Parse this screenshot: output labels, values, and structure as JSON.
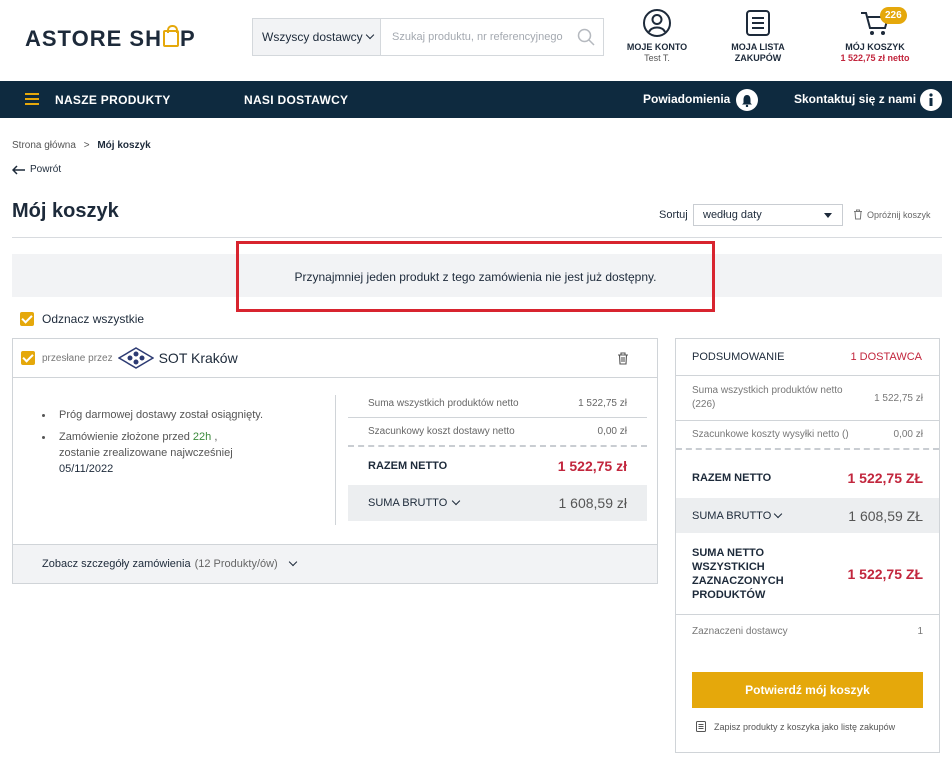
{
  "header": {
    "logo": {
      "part1": "ASTORE SH",
      "part2": "P"
    },
    "search": {
      "supplier_select": "Wszyscy dostawcy",
      "placeholder": "Szukaj produktu, nr referencyjnego"
    },
    "account": {
      "label": "MOJE KONTO",
      "user": "Test T."
    },
    "list": {
      "label_line1": "MOJA LISTA",
      "label_line2": "ZAKUPÓW"
    },
    "cart": {
      "label": "MÓJ KOSZYK",
      "badge": "226",
      "total": "1 522,75 zł netto"
    }
  },
  "nav": {
    "products": "NASZE PRODUKTY",
    "suppliers": "NASI DOSTAWCY",
    "notifications": "Powiadomienia",
    "contact": "Skontaktuj się z nami"
  },
  "breadcrumb": {
    "home": "Strona główna",
    "sep": ">",
    "current": "Mój koszyk"
  },
  "back": "Powrót",
  "page_title": "Mój koszyk",
  "sort": {
    "label": "Sortuj",
    "value": "według daty"
  },
  "empty_cart": "Opróżnij koszyk",
  "alert": "Przynajmniej jeden produkt z tego zamówienia nie jest już dostępny.",
  "select_all": "Odznacz wszystkie",
  "supplier_card": {
    "sent_by": "przesłane przez",
    "supplier_name": "SOT Kraków",
    "bullet1": "Próg darmowej dostawy został osiągnięty.",
    "bullet2_a": "Zamówienie złożone przed ",
    "bullet2_hour": "22h",
    "bullet2_b": " ,",
    "bullet2_c": "zostanie zrealizowane najwcześniej",
    "bullet2_date": "05/11/2022",
    "rows": {
      "products_label": "Suma wszystkich produktów netto",
      "products_value": "1 522,75 zł",
      "shipping_label": "Szacunkowy koszt dostawy netto",
      "shipping_value": "0,00 zł",
      "net_label": "RAZEM NETTO",
      "net_value": "1 522,75 zł",
      "gross_label": "SUMA BRUTTO",
      "gross_value": "1 608,59 zł"
    },
    "footer_label": "Zobacz szczegóły zamówienia",
    "footer_count": "(12 Produkty/ów)"
  },
  "summary": {
    "title": "PODSUMOWANIE",
    "suppliers_count": "1 DOSTAWCA",
    "products_label": "Suma wszystkich produktów netto (226)",
    "products_value": "1 522,75 zł",
    "shipping_label": "Szacunkowe koszty wysyłki netto ()",
    "shipping_value": "0,00 zł",
    "net_label": "RAZEM NETTO",
    "net_value": "1 522,75 ZŁ",
    "gross_label": "SUMA BRUTTO",
    "gross_value": "1 608,59 ZŁ",
    "selected_label": "SUMA NETTO WSZYSTKICH ZAZNACZONYCH PRODUKTÓW",
    "selected_value": "1 522,75 ZŁ",
    "selected_suppliers_label": "Zaznaczeni dostawcy",
    "selected_suppliers_value": "1",
    "confirm_button": "Potwierdź mój koszyk",
    "save_list": "Zapisz produkty z koszyka jako listę zakupów"
  },
  "colors": {
    "accent": "#e5a80b",
    "navy": "#0e2a3f",
    "price_red": "#c2263d",
    "alert_border": "#d8242f"
  }
}
